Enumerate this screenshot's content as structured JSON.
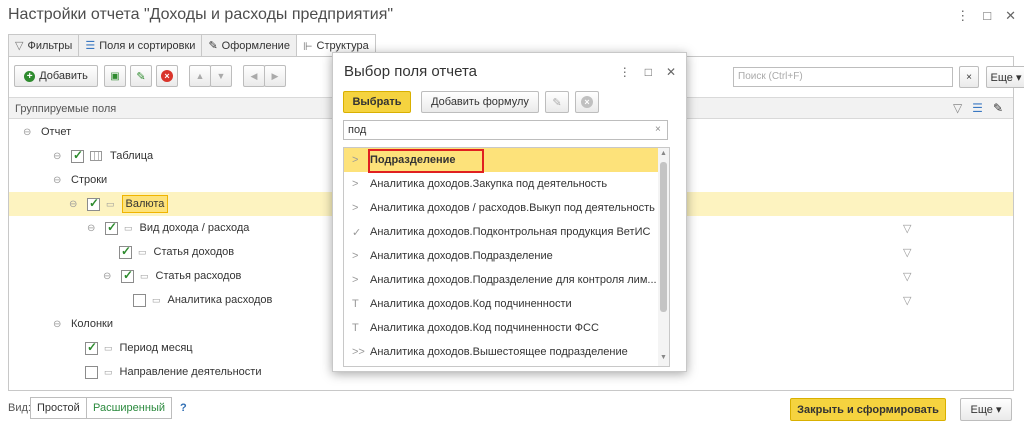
{
  "window": {
    "title": "Настройки отчета \"Доходы и расходы предприятия\"",
    "controls": [
      "⋮",
      "□",
      "✕"
    ]
  },
  "tabs": [
    {
      "label": "Фильтры",
      "icon": "filter-icon"
    },
    {
      "label": "Поля и сортировки",
      "icon": "fields-icon"
    },
    {
      "label": "Оформление",
      "icon": "brush-icon"
    },
    {
      "label": "Структура",
      "icon": "structure-icon",
      "active": true
    }
  ],
  "toolbar": {
    "add_label": "Добавить",
    "search_placeholder": "Поиск (Ctrl+F)",
    "search_clear": "×",
    "more_label": "Еще ▾"
  },
  "grid": {
    "header": "Группируемые поля",
    "rows": [
      {
        "toggle": "⊖",
        "label": "Отчет"
      },
      {
        "toggle": "⊖",
        "checked": true,
        "label": "Таблица"
      },
      {
        "toggle": "⊖",
        "label": "Строки"
      },
      {
        "toggle": "⊖",
        "checked": true,
        "label": "Валюта",
        "selected": true
      },
      {
        "toggle": "⊖",
        "checked": true,
        "label": "Вид дохода / расхода",
        "filter": true
      },
      {
        "checked": true,
        "label": "Статья доходов",
        "filter": true
      },
      {
        "toggle": "⊖",
        "checked": true,
        "label": "Статья расходов",
        "filter": true
      },
      {
        "checked": false,
        "label": "Аналитика расходов",
        "filter": true
      },
      {
        "toggle": "⊖",
        "label": "Колонки"
      },
      {
        "checked": true,
        "label": "Период месяц"
      },
      {
        "checked": false,
        "label": "Направление деятельности"
      }
    ]
  },
  "bottom": {
    "view_label": "Вид:",
    "simple_label": "Простой",
    "extended_label": "Расширенный",
    "help": "?",
    "close_label": "Закрыть и сформировать",
    "more_label": "Еще ▾"
  },
  "dialog": {
    "title": "Выбор поля отчета",
    "controls": [
      "⋮",
      "□",
      "✕"
    ],
    "choose_label": "Выбрать",
    "formula_label": "Добавить формулу",
    "search_value": "под",
    "search_clear": "×",
    "items": [
      {
        "marker": ">",
        "label": "Подразделение",
        "selected": true
      },
      {
        "marker": ">",
        "label": "Аналитика доходов.Закупка под деятельность"
      },
      {
        "marker": ">",
        "label": "Аналитика доходов / расходов.Выкуп под деятельность"
      },
      {
        "marker": "✓",
        "label": "Аналитика доходов.Подконтрольная продукция ВетИС"
      },
      {
        "marker": ">",
        "label": "Аналитика доходов.Подразделение"
      },
      {
        "marker": ">",
        "label": "Аналитика доходов.Подразделение для контроля лим..."
      },
      {
        "marker": "T",
        "label": "Аналитика доходов.Код подчиненности"
      },
      {
        "marker": "T",
        "label": "Аналитика доходов.Код подчиненности ФСС"
      },
      {
        "marker": ">>",
        "label": "Аналитика доходов.Вышестоящее подразделение"
      }
    ]
  }
}
